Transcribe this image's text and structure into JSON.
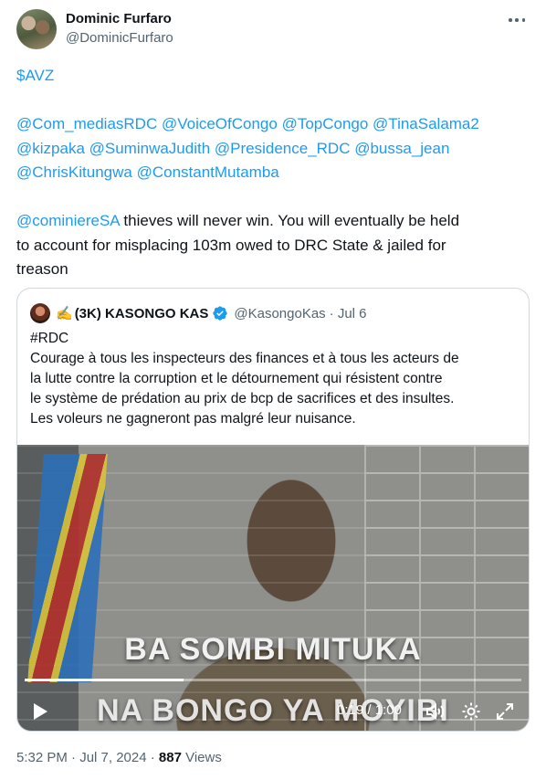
{
  "author": {
    "name": "Dominic Furfaro",
    "handle": "@DominicFurfaro",
    "avatar_icon": "profile-photo"
  },
  "tweet": {
    "line1": "$AVZ",
    "mentions_line1": "@Com_mediasRDC @VoiceOfCongo @TopCongo @TinaSalama2",
    "mentions_line2": "@kizpaka @SuminwaJudith @Presidence_RDC @bussa_jean",
    "mentions_line3": "@ChrisKitungwa @ConstantMutamba",
    "mention_target": "@cominiereSA",
    "text_line1": " thieves will never win. You will eventually be held",
    "text_line2": "to account for misplacing 103m owed to DRC State & jailed for",
    "text_line3": "treason"
  },
  "quoted": {
    "hand_emoji": "✍️",
    "name": "(3K) KASONGO KAS",
    "handle": "@KasongoKas",
    "date": "· Jul 6",
    "hashtag": "#RDC",
    "text_lines": [
      "Courage à tous les inspecteurs des finances et à tous les acteurs de",
      "la lutte contre la corruption et le détournement qui résistent contre",
      "le système de prédation au prix de bcp de sacrifices et des insultes.",
      "Les voleurs ne gagneront pas malgré leur nuisance."
    ],
    "video": {
      "caption_top": "BA SOMBI MITUKA",
      "caption_bottom": "NA BONGO YA MOYIBI",
      "time": "0:19 / 1:00",
      "progress": 0.32
    }
  },
  "meta": {
    "time": "5:32 PM · Jul 7, 2024 · ",
    "views_count": "887",
    "views_label": " Views"
  },
  "colors": {
    "link": "#1d9bf0",
    "text": "#0f1419",
    "secondary": "#536471",
    "border": "#cfd9de",
    "verified": "#1d9bf0"
  }
}
